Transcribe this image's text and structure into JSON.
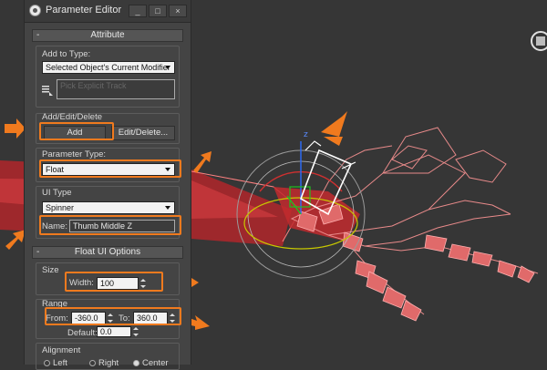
{
  "window": {
    "title": "Parameter Editor",
    "buttons": {
      "minimize": "_",
      "maximize": "□",
      "close": "×"
    }
  },
  "attribute": {
    "rollout_title": "Attribute",
    "collapse": "-",
    "add_to_type": {
      "label": "Add to Type:",
      "value": "Selected Object's Current Modifier"
    },
    "explicit_track": {
      "placeholder": "Pick Explicit Track"
    },
    "add_edit_delete": {
      "label": "Add/Edit/Delete",
      "add_button": "Add",
      "edit_button": "Edit/Delete..."
    },
    "parameter_type": {
      "label": "Parameter Type:",
      "value": "Float"
    },
    "ui_type": {
      "label": "UI Type",
      "value": "Spinner",
      "name_label": "Name:",
      "name_value": "Thumb Middle Z"
    }
  },
  "float_ui_options": {
    "rollout_title": "Float UI Options",
    "collapse": "-",
    "size": {
      "label": "Size",
      "width_label": "Width:",
      "width_value": "100"
    },
    "range": {
      "label": "Range",
      "from_label": "From:",
      "from_value": "-360.0",
      "to_label": "To:",
      "to_value": "360.0",
      "default_label": "Default:",
      "default_value": "0.0"
    },
    "alignment": {
      "label": "Alignment",
      "left": "Left",
      "right": "Right",
      "center": "Center",
      "selected": "center"
    }
  },
  "viewport": {
    "gizmo_axis_label": "z"
  },
  "colors": {
    "highlight": "#f07a1e",
    "bone": "#e06a6a",
    "viewport_bg": "#363636"
  }
}
